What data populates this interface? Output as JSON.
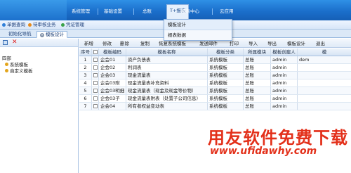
{
  "menu": {
    "items": [
      "系统管理",
      "基础设置",
      "总账",
      "报表中心",
      "云应用"
    ],
    "active_label": "T+报表"
  },
  "dropdown": {
    "items": [
      "模板设计",
      "报表数据"
    ]
  },
  "quickbar": {
    "links": [
      "单据查询",
      "待审核业务",
      "凭证管理"
    ]
  },
  "tabs": {
    "items": [
      "初始化导航",
      "模板设计"
    ]
  },
  "tree": {
    "root": "四部",
    "nodes": [
      "系统模板",
      "自定义模板"
    ]
  },
  "toolbar": {
    "actions": [
      "新增",
      "修改",
      "删除",
      "复制",
      "恢复系统模板",
      "发送邮件",
      "打印",
      "导入",
      "导出",
      "模板设计",
      "退出"
    ]
  },
  "table": {
    "headers": [
      "序号",
      "",
      "模板编码",
      "模板名称",
      "模板分类",
      "所属模块",
      "模板创建人",
      "模"
    ],
    "rows": [
      {
        "no": "1",
        "code": "企会01",
        "name": "资产负债表",
        "cat": "系统模板",
        "mod": "总账",
        "user": "admin",
        "extra": "dem"
      },
      {
        "no": "2",
        "code": "企会02",
        "name": "利润表",
        "cat": "系统模板",
        "mod": "总账",
        "user": "admin",
        "extra": ""
      },
      {
        "no": "3",
        "code": "企会03",
        "name": "现金流量表",
        "cat": "系统模板",
        "mod": "总账",
        "user": "admin",
        "extra": ""
      },
      {
        "no": "4",
        "code": "企会03附",
        "name": "现金流量表补充资料",
        "cat": "系统模板",
        "mod": "总账",
        "user": "admin",
        "extra": ""
      },
      {
        "no": "5",
        "code": "企会03明细",
        "name": "现金流量表（现金及现金等价物）",
        "cat": "系统模板",
        "mod": "总账",
        "user": "admin",
        "extra": ""
      },
      {
        "no": "6",
        "code": "企会03子",
        "name": "现金流量表附表（处置子公司信息）",
        "cat": "系统模板",
        "mod": "总账",
        "user": "admin",
        "extra": ""
      },
      {
        "no": "7",
        "code": "企会04",
        "name": "所有者权益变动表",
        "cat": "系统模板",
        "mod": "总账",
        "user": "admin",
        "extra": ""
      }
    ]
  },
  "watermark": {
    "brand": "用友软件免费下载",
    "url": "www.ufidawhy.com"
  },
  "colors": {
    "nav_blue": "#1b6fcb",
    "accent_red": "#e3301a",
    "folder_gold": "#e3a51c"
  }
}
